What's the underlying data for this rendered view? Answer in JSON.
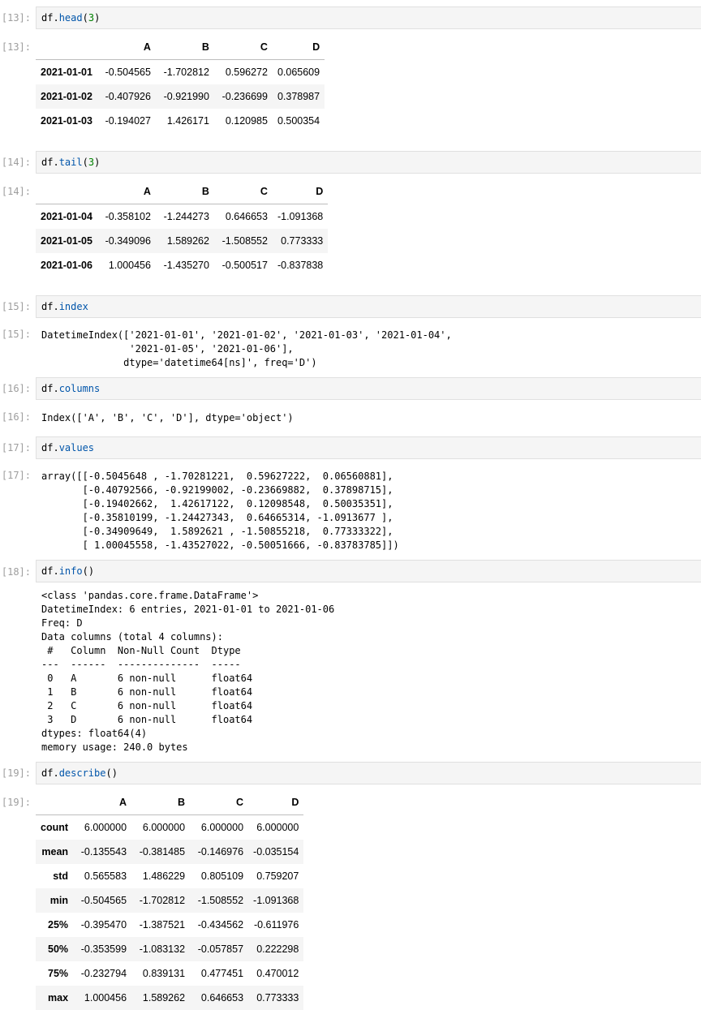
{
  "cells": [
    {
      "in_prompt": "[13]:",
      "out_prompt": "[13]:",
      "code": {
        "var": "df",
        "dot": ".",
        "method": "head",
        "open": "(",
        "arg": "3",
        "close": ")"
      },
      "table": {
        "columns": [
          "A",
          "B",
          "C",
          "D"
        ],
        "rows": [
          {
            "index": "2021-01-01",
            "values": [
              "-0.504565",
              "-1.702812",
              "0.596272",
              "0.065609"
            ]
          },
          {
            "index": "2021-01-02",
            "values": [
              "-0.407926",
              "-0.921990",
              "-0.236699",
              "0.378987"
            ]
          },
          {
            "index": "2021-01-03",
            "values": [
              "-0.194027",
              "1.426171",
              "0.120985",
              "0.500354"
            ]
          }
        ]
      }
    },
    {
      "in_prompt": "[14]:",
      "out_prompt": "[14]:",
      "code": {
        "var": "df",
        "dot": ".",
        "method": "tail",
        "open": "(",
        "arg": "3",
        "close": ")"
      },
      "table": {
        "columns": [
          "A",
          "B",
          "C",
          "D"
        ],
        "rows": [
          {
            "index": "2021-01-04",
            "values": [
              "-0.358102",
              "-1.244273",
              "0.646653",
              "-1.091368"
            ]
          },
          {
            "index": "2021-01-05",
            "values": [
              "-0.349096",
              "1.589262",
              "-1.508552",
              "0.773333"
            ]
          },
          {
            "index": "2021-01-06",
            "values": [
              "1.000456",
              "-1.435270",
              "-0.500517",
              "-0.837838"
            ]
          }
        ]
      }
    },
    {
      "in_prompt": "[15]:",
      "out_prompt": "[15]:",
      "code": {
        "var": "df",
        "dot": ".",
        "method": "index",
        "open": "",
        "arg": "",
        "close": ""
      },
      "text": "DatetimeIndex(['2021-01-01', '2021-01-02', '2021-01-03', '2021-01-04',\n               '2021-01-05', '2021-01-06'],\n              dtype='datetime64[ns]', freq='D')"
    },
    {
      "in_prompt": "[16]:",
      "out_prompt": "[16]:",
      "code": {
        "var": "df",
        "dot": ".",
        "method": "columns",
        "open": "",
        "arg": "",
        "close": ""
      },
      "text": "Index(['A', 'B', 'C', 'D'], dtype='object')"
    },
    {
      "in_prompt": "[17]:",
      "out_prompt": "[17]:",
      "code": {
        "var": "df",
        "dot": ".",
        "method": "values",
        "open": "",
        "arg": "",
        "close": ""
      },
      "text": "array([[-0.5045648 , -1.70281221,  0.59627222,  0.06560881],\n       [-0.40792566, -0.92199002, -0.23669882,  0.37898715],\n       [-0.19402662,  1.42617122,  0.12098548,  0.50035351],\n       [-0.35810199, -1.24427343,  0.64665314, -1.0913677 ],\n       [-0.34909649,  1.5892621 , -1.50855218,  0.77333322],\n       [ 1.00045558, -1.43527022, -0.50051666, -0.83783785]])"
    },
    {
      "in_prompt": "[18]:",
      "out_prompt": "",
      "code": {
        "var": "df",
        "dot": ".",
        "method": "info",
        "open": "(",
        "arg": "",
        "close": ")"
      },
      "text": "<class 'pandas.core.frame.DataFrame'>\nDatetimeIndex: 6 entries, 2021-01-01 to 2021-01-06\nFreq: D\nData columns (total 4 columns):\n #   Column  Non-Null Count  Dtype  \n---  ------  --------------  -----  \n 0   A       6 non-null      float64\n 1   B       6 non-null      float64\n 2   C       6 non-null      float64\n 3   D       6 non-null      float64\ndtypes: float64(4)\nmemory usage: 240.0 bytes"
    },
    {
      "in_prompt": "[19]:",
      "out_prompt": "[19]:",
      "code": {
        "var": "df",
        "dot": ".",
        "method": "describe",
        "open": "(",
        "arg": "",
        "close": ")"
      },
      "table": {
        "columns": [
          "A",
          "B",
          "C",
          "D"
        ],
        "rows": [
          {
            "index": "count",
            "values": [
              "6.000000",
              "6.000000",
              "6.000000",
              "6.000000"
            ]
          },
          {
            "index": "mean",
            "values": [
              "-0.135543",
              "-0.381485",
              "-0.146976",
              "-0.035154"
            ]
          },
          {
            "index": "std",
            "values": [
              "0.565583",
              "1.486229",
              "0.805109",
              "0.759207"
            ]
          },
          {
            "index": "min",
            "values": [
              "-0.504565",
              "-1.702812",
              "-1.508552",
              "-1.091368"
            ]
          },
          {
            "index": "25%",
            "values": [
              "-0.395470",
              "-1.387521",
              "-0.434562",
              "-0.611976"
            ]
          },
          {
            "index": "50%",
            "values": [
              "-0.353599",
              "-1.083132",
              "-0.057857",
              "0.222298"
            ]
          },
          {
            "index": "75%",
            "values": [
              "-0.232794",
              "0.839131",
              "0.477451",
              "0.470012"
            ]
          },
          {
            "index": "max",
            "values": [
              "1.000456",
              "1.589262",
              "0.646653",
              "0.773333"
            ]
          }
        ]
      }
    }
  ]
}
